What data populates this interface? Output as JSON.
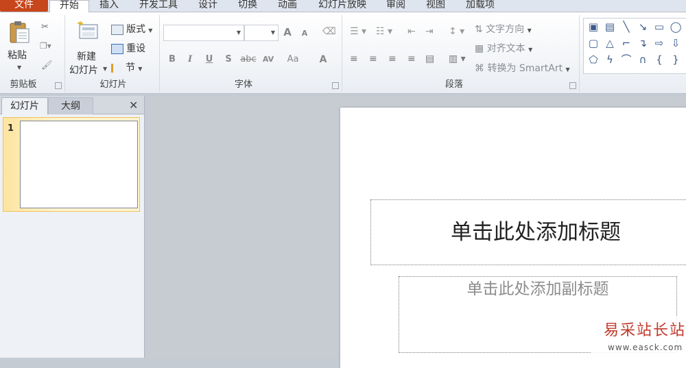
{
  "tabs": {
    "file": "文件",
    "home": "开始",
    "insert": "插入",
    "developer": "开发工具",
    "design": "设计",
    "transitions": "切换",
    "animations": "动画",
    "slideshow": "幻灯片放映",
    "review": "审阅",
    "view": "视图",
    "addins": "加载项"
  },
  "clipboard": {
    "paste": "粘贴",
    "label": "剪贴板"
  },
  "slides_group": {
    "new_slide_line1": "新建",
    "new_slide_line2": "幻灯片",
    "layout": "版式",
    "reset": "重设",
    "section": "节",
    "label": "幻灯片"
  },
  "font_group": {
    "label": "字体",
    "bold": "B",
    "italic": "I",
    "underline": "U",
    "shadow": "S",
    "strike": "abc",
    "spacing": "AV",
    "case": "Aa",
    "color": "A",
    "grow": "A",
    "shrink": "A"
  },
  "paragraph_group": {
    "label": "段落",
    "text_direction": "文字方向",
    "align_text": "对齐文本",
    "convert_smartart": "转换为 SmartArt"
  },
  "panel": {
    "tab_slides": "幻灯片",
    "tab_outline": "大纲",
    "close": "✕",
    "slide_number": "1"
  },
  "slide": {
    "title_placeholder": "单击此处添加标题",
    "subtitle_placeholder": "单击此处添加副标题"
  },
  "watermark": {
    "text": "易采站长站",
    "url": "www.easck.com"
  },
  "colors": {
    "file_tab": "#c8461c",
    "ribbon_bg": "#f3f5f8",
    "panel_bg": "#eef1f5",
    "selected_thumb": "#fde4a0"
  }
}
